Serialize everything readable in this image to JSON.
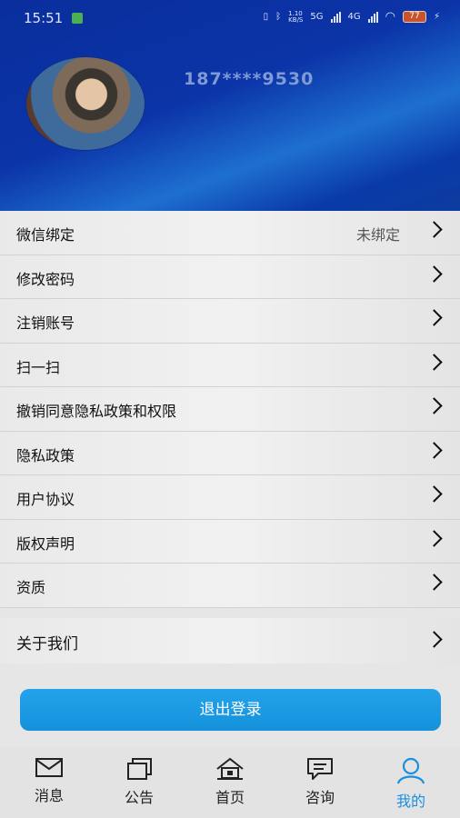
{
  "status_bar": {
    "time": "15:51",
    "speed": "1.10\nKB/S",
    "network": "5G",
    "network2": "4G",
    "battery": "77"
  },
  "profile": {
    "phone": "187****9530"
  },
  "menu": {
    "items": [
      {
        "label": "微信绑定",
        "value": "未绑定"
      },
      {
        "label": "修改密码",
        "value": ""
      },
      {
        "label": "注销账号",
        "value": ""
      },
      {
        "label": "扫一扫",
        "value": ""
      },
      {
        "label": "撤销同意隐私政策和权限",
        "value": ""
      },
      {
        "label": "隐私政策",
        "value": ""
      },
      {
        "label": "用户协议",
        "value": ""
      },
      {
        "label": "版权声明",
        "value": ""
      },
      {
        "label": "资质",
        "value": ""
      }
    ],
    "about": "关于我们"
  },
  "logout_label": "退出登录",
  "tabbar": {
    "tabs": [
      {
        "label": "消息",
        "icon": "mail-icon"
      },
      {
        "label": "公告",
        "icon": "notice-icon"
      },
      {
        "label": "首页",
        "icon": "home-icon"
      },
      {
        "label": "咨询",
        "icon": "chat-icon"
      },
      {
        "label": "我的",
        "icon": "user-icon"
      }
    ],
    "active_color": "#1a8fe0"
  }
}
